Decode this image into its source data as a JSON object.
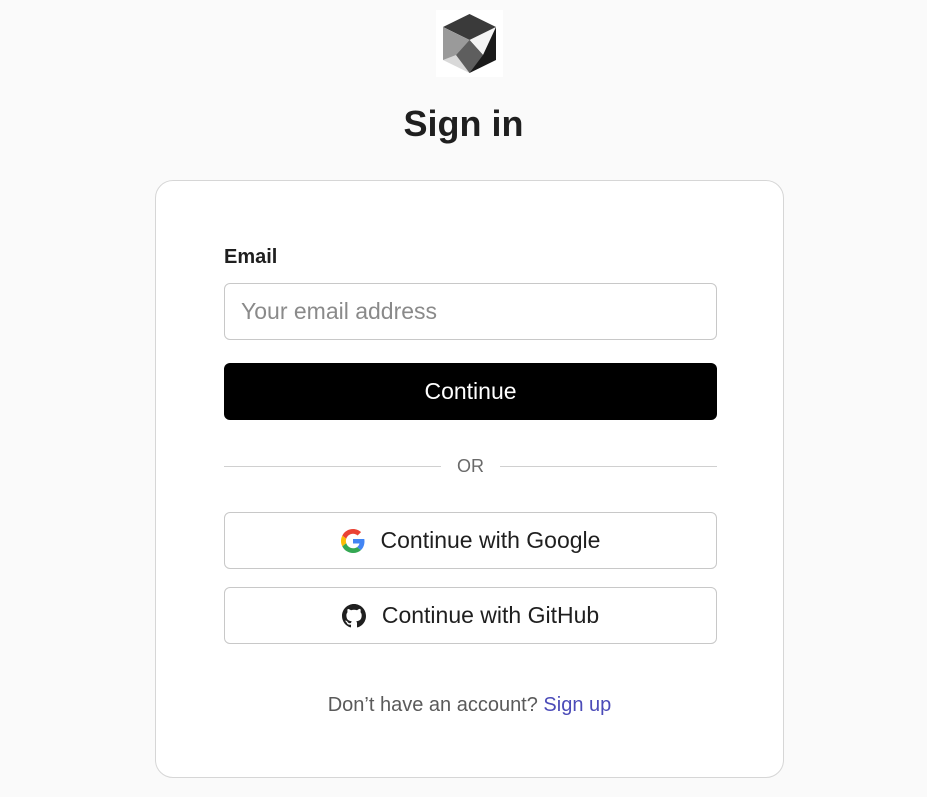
{
  "header": {
    "logo_icon": "cube-logo-icon",
    "title": "Sign in"
  },
  "form": {
    "email_label": "Email",
    "email_value": "",
    "email_placeholder": "Your email address",
    "continue_label": "Continue",
    "divider_text": "OR",
    "google_label": "Continue with Google",
    "google_icon": "google-icon",
    "github_label": "Continue with GitHub",
    "github_icon": "github-icon",
    "signup_prompt": "Don’t have an account?",
    "signup_link": "Sign up"
  },
  "colors": {
    "background": "#fafafa",
    "primary_button": "#000000",
    "link": "#4b4bb8",
    "border": "#c8c8c8"
  }
}
